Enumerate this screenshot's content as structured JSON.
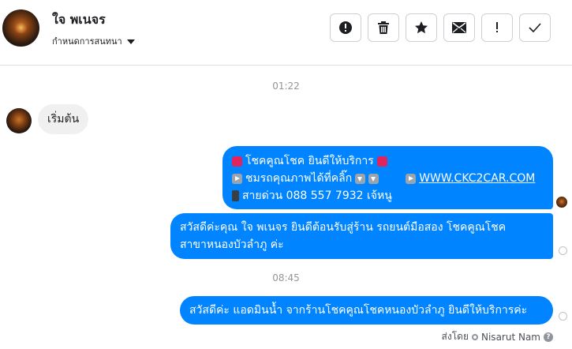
{
  "header": {
    "contact_name": "ใจ พเนจร",
    "subtitle": "กำหนดการสนทนา",
    "toolbar": [
      {
        "name": "report-button",
        "icon": "exclamation-circle-icon"
      },
      {
        "name": "delete-button",
        "icon": "trash-icon"
      },
      {
        "name": "star-button",
        "icon": "star-icon"
      },
      {
        "name": "mark-unread-button",
        "icon": "envelope-icon"
      },
      {
        "name": "important-button",
        "icon": "exclamation-icon"
      },
      {
        "name": "done-button",
        "icon": "check-icon"
      }
    ]
  },
  "timestamps": {
    "first": "01:22",
    "second": "08:45"
  },
  "messages": {
    "incoming": {
      "text": "เริ่มต้น"
    },
    "outgoing1": {
      "line1": "โชคคูณโชค ยินดีให้บริการ",
      "line2_text": "ชมรถคุณภาพได้ที่คลิ๊ก",
      "line2_link": "WWW.CKC2CAR.COM",
      "line3": "สายด่วน 088 557 7932 เจ้หนู"
    },
    "outgoing2": {
      "line1": "สวัสดีค่ะคุณ ใจ พเนจร ยินดีต้อนรับสู่ร้าน รถยนต์มือสอง โชคคูณโชค",
      "line2": "สาขาหนองบัวลำภู ค่ะ"
    },
    "outgoing3": {
      "text": "สวัสดีค่ะ แอดมินน้ำ จากร้านโชคคูณโชคหนองบัวลำภู ยินดีให้บริการค่ะ"
    }
  },
  "footer": {
    "sent_by_label": "ส่งโดย",
    "sender": "Nisarut Nam",
    "help": "?"
  },
  "colors": {
    "bubble_out": "#0084ff",
    "bubble_in": "#f1f0f0",
    "timestamp": "#90949c"
  }
}
